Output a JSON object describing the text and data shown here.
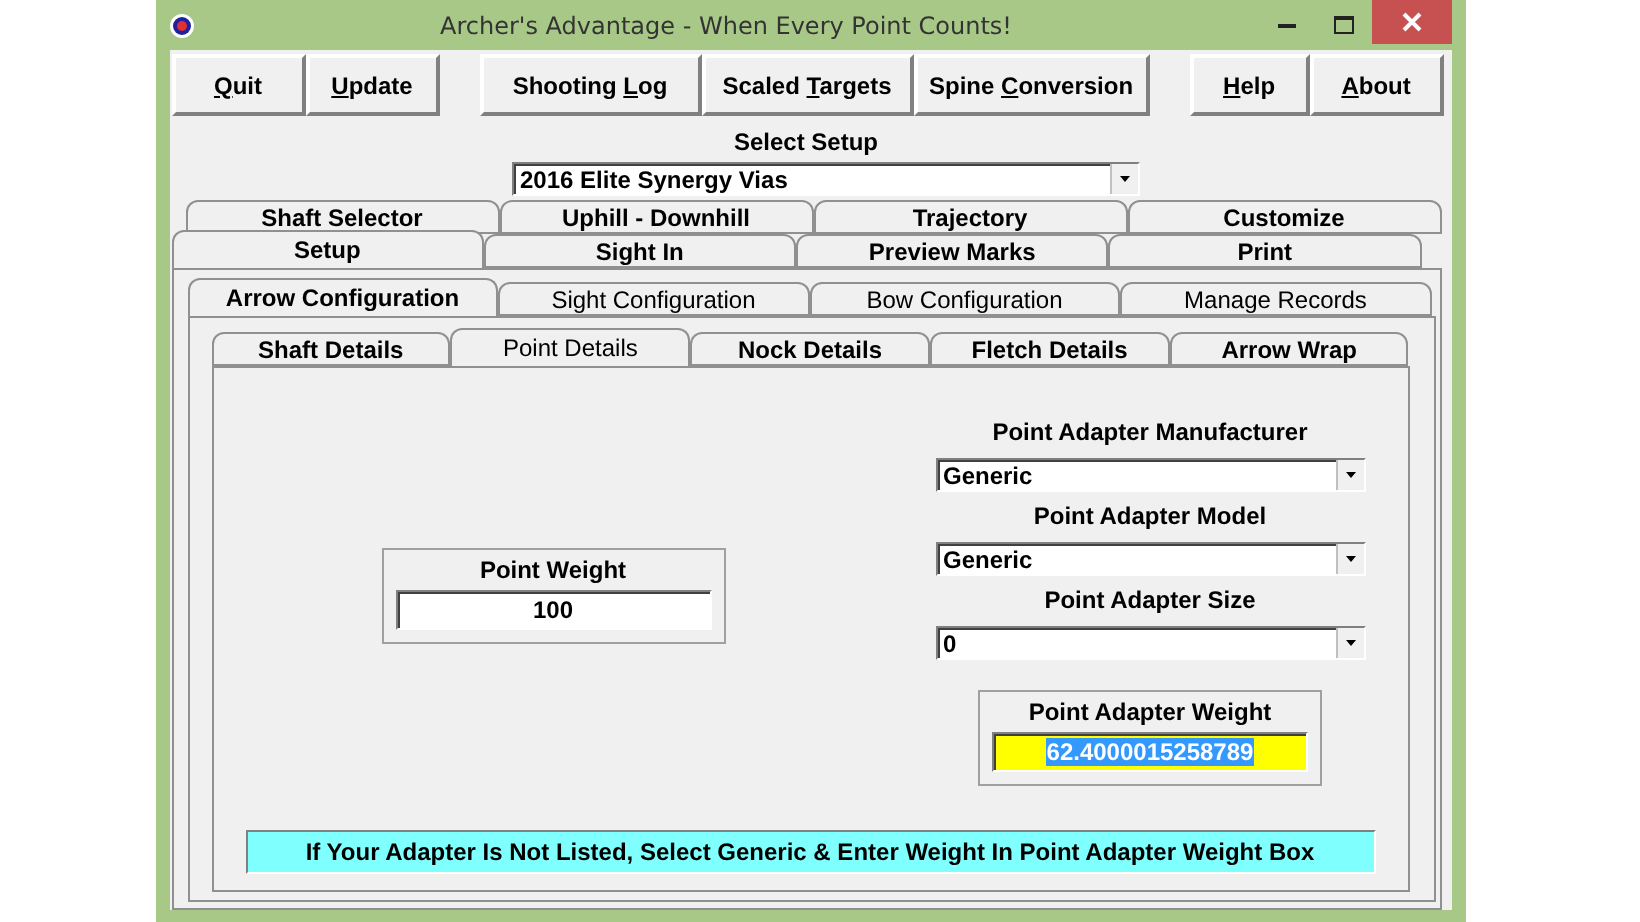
{
  "window": {
    "title": "Archer's Advantage - When Every Point Counts!"
  },
  "menu_groups": [
    [
      {
        "key": "Q",
        "post": "uit"
      },
      {
        "key": "U",
        "post": "pdate"
      }
    ],
    [
      {
        "pre": "Shooting ",
        "key": "L",
        "post": "og"
      },
      {
        "pre": "Scaled ",
        "key": "T",
        "post": "argets"
      },
      {
        "pre": "Spine ",
        "key": "C",
        "post": "onversion"
      }
    ],
    [
      {
        "key": "H",
        "post": "elp"
      },
      {
        "key": "A",
        "post": "bout"
      }
    ]
  ],
  "setup": {
    "label": "Select Setup",
    "value": "2016 Elite Synergy Vias"
  },
  "main_tabs_back": [
    {
      "label": "Shaft Selector",
      "selected": false
    },
    {
      "label": "Uphill - Downhill",
      "selected": false
    },
    {
      "label": "Trajectory",
      "selected": false
    },
    {
      "label": "Customize",
      "selected": false
    }
  ],
  "main_tabs_front": [
    {
      "label": "Setup",
      "selected": true
    },
    {
      "label": "Sight In",
      "selected": false
    },
    {
      "label": "Preview Marks",
      "selected": false
    },
    {
      "label": "Print",
      "selected": false
    }
  ],
  "config_tabs": [
    {
      "label": "Arrow Configuration",
      "selected": true
    },
    {
      "label": "Sight Configuration",
      "selected": false
    },
    {
      "label": "Bow Configuration",
      "selected": false
    },
    {
      "label": "Manage Records",
      "selected": false
    }
  ],
  "arrow_tabs": [
    {
      "label": "Shaft Details",
      "selected": false
    },
    {
      "label": "Point Details",
      "selected": true
    },
    {
      "label": "Nock Details",
      "selected": false
    },
    {
      "label": "Fletch Details",
      "selected": false
    },
    {
      "label": "Arrow Wrap",
      "selected": false
    }
  ],
  "point_weight": {
    "label": "Point Weight",
    "value": "100"
  },
  "adapter_fields": [
    {
      "label": "Point Adapter Manufacturer",
      "value": "Generic"
    },
    {
      "label": "Point Adapter Model",
      "value": "Generic"
    },
    {
      "label": "Point Adapter Size",
      "value": "0"
    }
  ],
  "adapter_weight": {
    "label": "Point Adapter Weight",
    "value": "62.4000015258789",
    "selected": true
  },
  "info": "If Your Adapter Is Not Listed, Select Generic & Enter Weight In Point Adapter Weight Box"
}
